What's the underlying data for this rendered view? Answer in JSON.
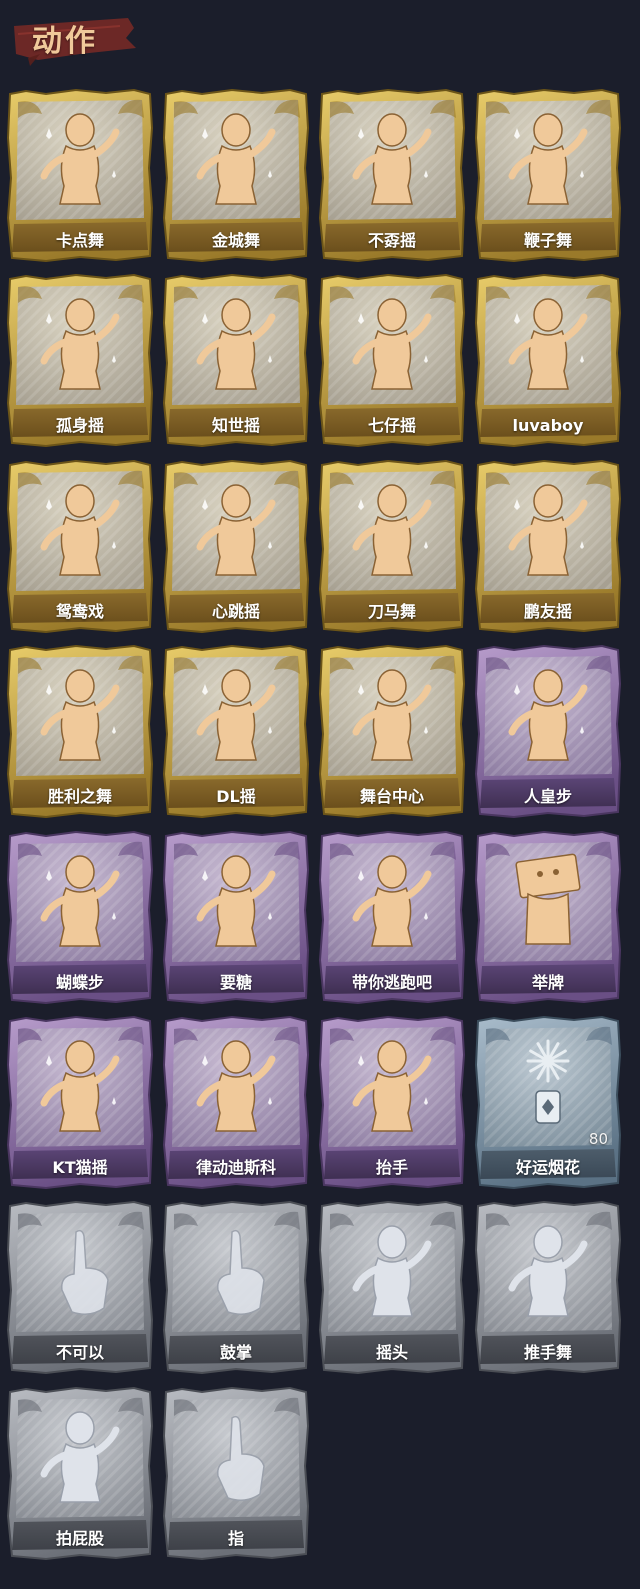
{
  "section": {
    "title": "动作"
  },
  "colors": {
    "background": "#1b1e2b",
    "gold": "#c9a13a",
    "purple": "#8a6aa0",
    "blue": "#6f8596",
    "gray": "#8a8e96",
    "gold_figure": "#f0c99a",
    "label_text": "#ffffff"
  },
  "actions": [
    {
      "label": "卡点舞",
      "rarity": "gold",
      "icon": "dance-pose-icon"
    },
    {
      "label": "金城舞",
      "rarity": "gold",
      "icon": "dance-pose-icon"
    },
    {
      "label": "不孬摇",
      "rarity": "gold",
      "icon": "dance-pose-icon"
    },
    {
      "label": "鞭子舞",
      "rarity": "gold",
      "icon": "dance-pose-icon"
    },
    {
      "label": "孤身摇",
      "rarity": "gold",
      "icon": "dance-pose-icon"
    },
    {
      "label": "知世摇",
      "rarity": "gold",
      "icon": "dance-pose-icon"
    },
    {
      "label": "七仔摇",
      "rarity": "gold",
      "icon": "dance-pose-icon"
    },
    {
      "label": "luvaboy",
      "rarity": "gold",
      "icon": "dance-pose-icon"
    },
    {
      "label": "鸳鸯戏",
      "rarity": "gold",
      "icon": "dance-pose-icon"
    },
    {
      "label": "心跳摇",
      "rarity": "gold",
      "icon": "dance-pose-icon"
    },
    {
      "label": "刀马舞",
      "rarity": "gold",
      "icon": "dance-pose-icon"
    },
    {
      "label": "鹏友摇",
      "rarity": "gold",
      "icon": "dance-pose-icon"
    },
    {
      "label": "胜利之舞",
      "rarity": "gold",
      "icon": "dance-pose-icon"
    },
    {
      "label": "DL摇",
      "rarity": "gold",
      "icon": "dance-pose-icon"
    },
    {
      "label": "舞台中心",
      "rarity": "gold",
      "icon": "dance-pose-icon"
    },
    {
      "label": "人皇步",
      "rarity": "purple",
      "icon": "dance-pose-icon"
    },
    {
      "label": "蝴蝶步",
      "rarity": "purple",
      "icon": "dance-pose-icon"
    },
    {
      "label": "要糖",
      "rarity": "purple",
      "icon": "figure-silhouette-icon"
    },
    {
      "label": "带你逃跑吧",
      "rarity": "purple",
      "icon": "dance-pose-icon"
    },
    {
      "label": "举牌",
      "rarity": "purple",
      "icon": "sign-board-icon"
    },
    {
      "label": "KT猫摇",
      "rarity": "purple",
      "icon": "dance-pose-icon"
    },
    {
      "label": "律动迪斯科",
      "rarity": "purple",
      "icon": "dance-pose-icon"
    },
    {
      "label": "抬手",
      "rarity": "purple",
      "icon": "figure-silhouette-icon"
    },
    {
      "label": "好运烟花",
      "rarity": "blue",
      "icon": "firework-icon",
      "count": "80"
    },
    {
      "label": "不可以",
      "rarity": "gray",
      "icon": "finger-wag-icon"
    },
    {
      "label": "鼓掌",
      "rarity": "gray",
      "icon": "clapping-hands-icon"
    },
    {
      "label": "摇头",
      "rarity": "gray",
      "icon": "figure-silhouette-icon"
    },
    {
      "label": "推手舞",
      "rarity": "gray",
      "icon": "figure-silhouette-icon"
    },
    {
      "label": "拍屁股",
      "rarity": "gray",
      "icon": "figure-silhouette-icon"
    },
    {
      "label": "指",
      "rarity": "gray",
      "icon": "pointing-hand-icon"
    }
  ]
}
